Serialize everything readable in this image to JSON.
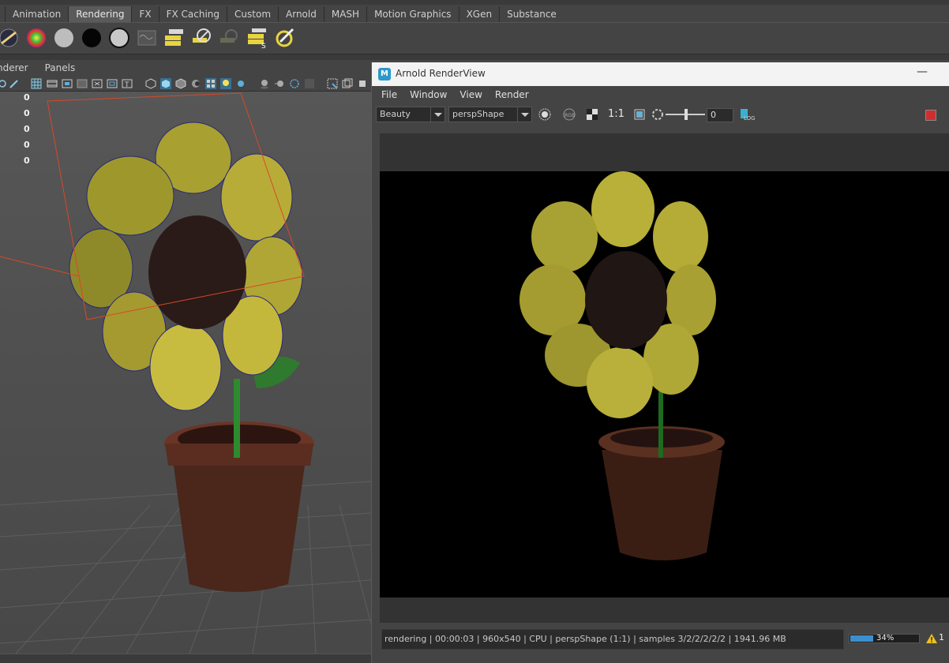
{
  "shelf": {
    "tabs": [
      "Animation",
      "Rendering",
      "FX",
      "FX Caching",
      "Custom",
      "Arnold",
      "MASH",
      "Motion Graphics",
      "XGen",
      "Substance"
    ],
    "active_tab": "Rendering"
  },
  "viewport": {
    "menus": [
      "nderer",
      "Panels"
    ],
    "hud_values": [
      "0",
      "0",
      "0",
      "0",
      "0"
    ]
  },
  "renderview": {
    "title": "Arnold RenderView",
    "minimize": "—",
    "menus": [
      "File",
      "Window",
      "View",
      "Render"
    ],
    "aov": "Beauty",
    "camera": "perspShape",
    "ratio": "1:1",
    "exposure": "0",
    "log_label": "LOG",
    "rgb_label": "RGB",
    "status": "rendering | 00:00:03 | 960x540 | CPU | perspShape (1:1) | samples 3/2/2/2/2/2 | 1941.96 MB",
    "progress": {
      "percent_label": "34%",
      "fraction": 0.34
    },
    "warnings": "1"
  },
  "colors": {
    "accent": "#3b8fd0",
    "stop": "#d02e2e",
    "petal": "#c8c43c",
    "pot": "#5a3020"
  }
}
